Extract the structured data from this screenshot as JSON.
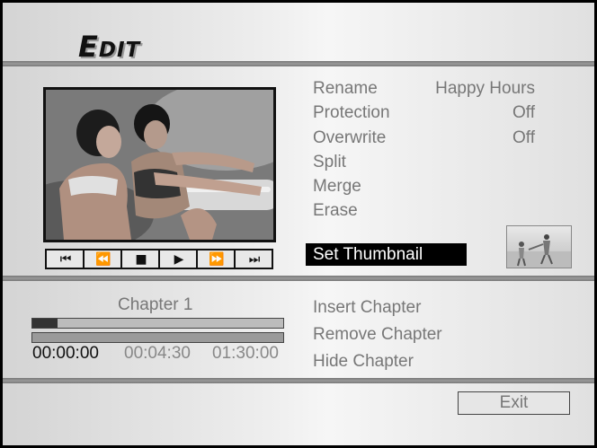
{
  "header": {
    "title_first": "E",
    "title_rest": "DIT"
  },
  "player": {
    "controls": [
      {
        "name": "skip-back-icon",
        "glyph": "⏮"
      },
      {
        "name": "rewind-icon",
        "glyph": "⏪"
      },
      {
        "name": "stop-icon",
        "glyph": "■"
      },
      {
        "name": "play-icon",
        "glyph": "▶"
      },
      {
        "name": "fast-forward-icon",
        "glyph": "⏩"
      },
      {
        "name": "skip-forward-icon",
        "glyph": "⏭"
      }
    ]
  },
  "menu": {
    "rename": {
      "label": "Rename",
      "value": "Happy Hours"
    },
    "protection": {
      "label": "Protection",
      "value": "Off"
    },
    "overwrite": {
      "label": "Overwrite",
      "value": "Off"
    },
    "split": {
      "label": "Split"
    },
    "merge": {
      "label": "Merge"
    },
    "erase": {
      "label": "Erase"
    },
    "set_thumbnail": {
      "label": "Set Thumbnail"
    }
  },
  "chapter": {
    "label": "Chapter 1",
    "progress": 0.1,
    "current_time": "00:00:00",
    "chapter_time": "00:04:30",
    "total_time": "01:30:00"
  },
  "chapter_menu": {
    "insert": "Insert Chapter",
    "remove": "Remove Chapter",
    "hide": "Hide Chapter"
  },
  "footer": {
    "exit_label": "Exit"
  },
  "colors": {
    "selected_bg": "#000000",
    "inactive_text": "#777777"
  }
}
